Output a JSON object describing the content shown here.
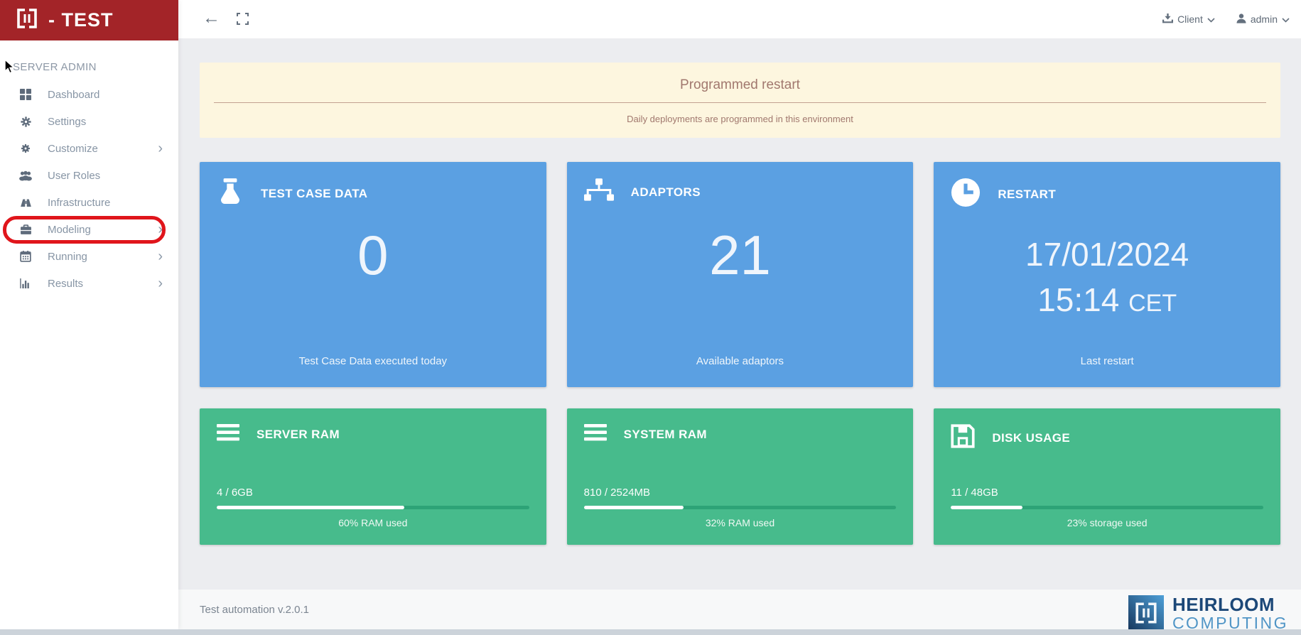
{
  "sidebar": {
    "logo_text": "- TEST",
    "section_label": "SERVER ADMIN",
    "chevron_glyph": "›",
    "items": [
      {
        "label": "Dashboard",
        "icon": "dashboard-icon",
        "has_submenu": false
      },
      {
        "label": "Settings",
        "icon": "gear-icon",
        "has_submenu": false
      },
      {
        "label": "Customize",
        "icon": "cog-icon",
        "has_submenu": true
      },
      {
        "label": "User Roles",
        "icon": "users-icon",
        "has_submenu": false
      },
      {
        "label": "Infrastructure",
        "icon": "binoculars-icon",
        "has_submenu": false
      },
      {
        "label": "Modeling",
        "icon": "briefcase-icon",
        "has_submenu": true,
        "annotated": true
      },
      {
        "label": "Running",
        "icon": "calendar-icon",
        "has_submenu": true
      },
      {
        "label": "Results",
        "icon": "bar-chart-icon",
        "has_submenu": true
      }
    ]
  },
  "topbar": {
    "back_glyph": "←",
    "client_label": "Client",
    "user_label": "admin"
  },
  "alert": {
    "title": "Programmed restart",
    "message": "Daily deployments are programmed in this environment"
  },
  "stat_cards": [
    {
      "title": "TEST CASE DATA",
      "icon": "flask-icon",
      "value": "0",
      "caption": "Test Case Data executed today"
    },
    {
      "title": "ADAPTORS",
      "icon": "sitemap-icon",
      "value": "21",
      "caption": "Available adaptors"
    },
    {
      "title": "RESTART",
      "icon": "clock-icon",
      "date": "17/01/2024",
      "time": "15:14",
      "timezone": "CET",
      "caption": "Last restart"
    }
  ],
  "gauge_cards": [
    {
      "title": "SERVER RAM",
      "icon": "bars-icon",
      "usage": "4 / 6GB",
      "percent": 60,
      "caption": "60% RAM used"
    },
    {
      "title": "SYSTEM RAM",
      "icon": "bars-icon",
      "usage": "810 / 2524MB",
      "percent": 32,
      "caption": "32% RAM used"
    },
    {
      "title": "DISK USAGE",
      "icon": "floppy-icon",
      "usage": "11 / 48GB",
      "percent": 23,
      "caption": "23% storage used"
    }
  ],
  "footer": {
    "version": "Test automation v.2.0.1",
    "brand_top": "HEIRLOOM",
    "brand_bottom": "COMPUTING"
  },
  "colors": {
    "brand_red": "#a32428",
    "card_blue": "#5ba0e2",
    "card_green": "#47bb8c",
    "annotation_red": "#e0151b",
    "alert_bg": "#fdf6df",
    "alert_text": "#a1786e"
  }
}
